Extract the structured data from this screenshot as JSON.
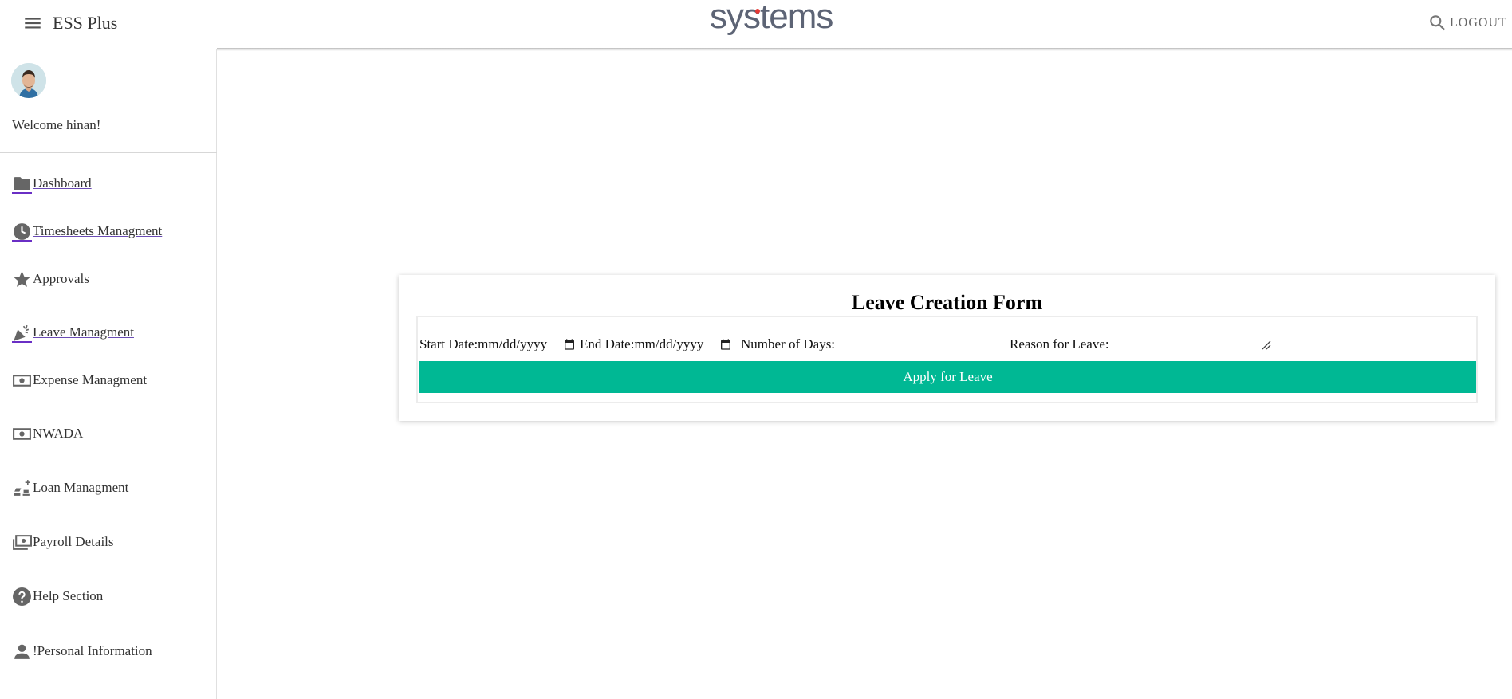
{
  "header": {
    "app_name": "ESS Plus",
    "logo_text": "systems",
    "logout_label": "LOGOUT",
    "menu_icon": "hamburger-icon",
    "search_icon": "search-icon",
    "accent_color": "#00b894",
    "logo_dot_color": "#e53935"
  },
  "sidebar": {
    "welcome": "Welcome hinan!",
    "items": [
      {
        "label": "Dashboard",
        "icon": "folder-icon",
        "link": true
      },
      {
        "label": "Timesheets Managment",
        "icon": "clock-icon",
        "link": true
      },
      {
        "label": "Approvals",
        "icon": "star-icon",
        "link": false
      },
      {
        "label": "Leave Managment",
        "icon": "celebration-icon",
        "link": true
      },
      {
        "label": "Expense Managment",
        "icon": "money-icon",
        "link": false
      },
      {
        "label": "NWADA",
        "icon": "money-icon",
        "link": false
      },
      {
        "label": "Loan Managment",
        "icon": "bank-icon",
        "link": false
      },
      {
        "label": "Payroll Details",
        "icon": "payments-icon",
        "link": false
      },
      {
        "label": "Help Section",
        "icon": "help-icon",
        "link": false
      },
      {
        "label": "!Personal Information",
        "icon": "person-icon",
        "link": false
      }
    ]
  },
  "form": {
    "title": "Leave Creation Form",
    "start_date_label": "Start Date:",
    "start_date_value": "mm/dd/yyyy",
    "end_date_label": "End Date:",
    "end_date_value": "mm/dd/yyyy",
    "days_label": "Number of Days:",
    "reason_label": "Reason for Leave:",
    "submit_label": "Apply for Leave"
  }
}
